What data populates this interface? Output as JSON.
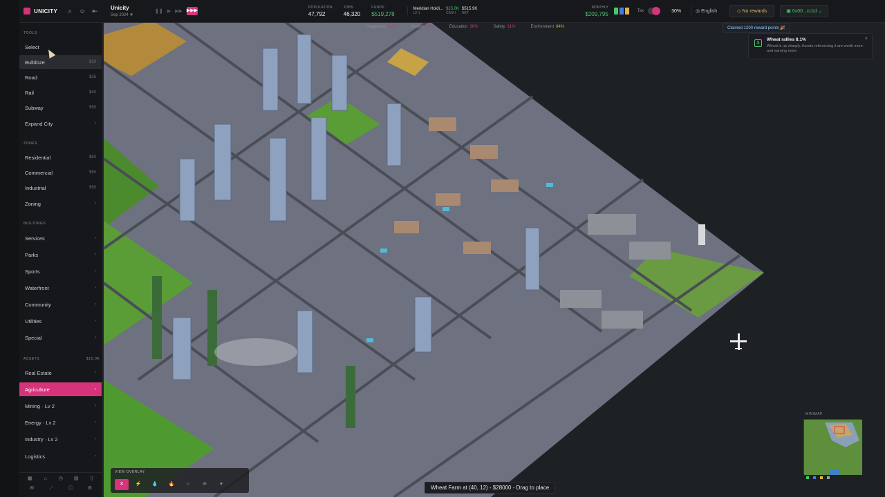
{
  "app": {
    "name": "UNICITY"
  },
  "city": {
    "name": "Unicity",
    "date": "Sep 2024"
  },
  "speed": {
    "fast_label": "▶▶▶"
  },
  "stats": {
    "population_label": "POPULATION",
    "population": "47,792",
    "jobs_label": "JOBS",
    "jobs": "46,320",
    "funds_label": "FUNDS",
    "funds": "$519,278"
  },
  "company": {
    "name": "Meridian Holdi...",
    "sub": "LV 1",
    "cash": "$15.0K",
    "cash_label": "CASH",
    "net": "$515.9K",
    "net_label": "NET"
  },
  "monthly": {
    "label": "MONTHLY",
    "value": "$209,795"
  },
  "tax": {
    "label": "Tax",
    "percent": "30%"
  },
  "language": "English",
  "rewards": "No rewards",
  "wallet": "0x00...cc1d",
  "metrics": [
    {
      "label": "Happiness",
      "value": "47%"
    },
    {
      "label": "Health",
      "value": "41%"
    },
    {
      "label": "Education",
      "value": "36%"
    },
    {
      "label": "Safety",
      "value": "31%"
    },
    {
      "label": "Environment",
      "value": "84%"
    }
  ],
  "claimed_toast": "Claimed 1200 reward points 🎉",
  "notification": {
    "title": "Wheat rallies 8.1%",
    "body": "Wheat is up sharply. Assets referencing it are worth more and earning more",
    "close": "×"
  },
  "sidebar": {
    "tools_title": "TOOLS",
    "tools": [
      {
        "label": "Select",
        "cost": ""
      },
      {
        "label": "Bulldoze",
        "cost": "$10"
      },
      {
        "label": "Road",
        "cost": "$25"
      },
      {
        "label": "Rail",
        "cost": "$40"
      },
      {
        "label": "Subway",
        "cost": "$50"
      },
      {
        "label": "Expand City",
        "cost": "›"
      }
    ],
    "zones_title": "ZONES",
    "zones": [
      {
        "label": "Residential",
        "cost": "$50"
      },
      {
        "label": "Commercial",
        "cost": "$50"
      },
      {
        "label": "Industrial",
        "cost": "$50"
      },
      {
        "label": "Zoning",
        "cost": "›"
      }
    ],
    "buildings_title": "BUILDINGS",
    "buildings": [
      {
        "label": "Services",
        "cost": "›"
      },
      {
        "label": "Parks",
        "cost": "›"
      },
      {
        "label": "Sports",
        "cost": "›"
      },
      {
        "label": "Waterfront",
        "cost": "›"
      },
      {
        "label": "Community",
        "cost": "›"
      },
      {
        "label": "Utilities",
        "cost": "›"
      },
      {
        "label": "Special",
        "cost": "›"
      }
    ],
    "assets_title": "ASSETS",
    "assets_value": "$15.0K",
    "assets": [
      {
        "label": "Real Estate",
        "cost": "›"
      },
      {
        "label": "Agriculture",
        "cost": "›"
      },
      {
        "label": "Mining · Lv 2",
        "cost": "›"
      },
      {
        "label": "Energy · Lv 2",
        "cost": "›"
      },
      {
        "label": "Industry · Lv 2",
        "cost": "›"
      },
      {
        "label": "Logistics",
        "cost": "›"
      }
    ]
  },
  "view_overlay": {
    "label": "VIEW OVERLAY",
    "buttons": [
      "✕",
      "⚡",
      "💧",
      "🔥",
      "☺",
      "⊕",
      "♥",
      "⚑",
      "⌂"
    ]
  },
  "place_tip": "Wheat Farm at (40, 12) - $28000 - Drag to place",
  "minimap": {
    "label": "MINIMAP"
  },
  "colors": {
    "accent": "#d6337a",
    "positive": "#46c86a",
    "background": "#1f2326"
  }
}
